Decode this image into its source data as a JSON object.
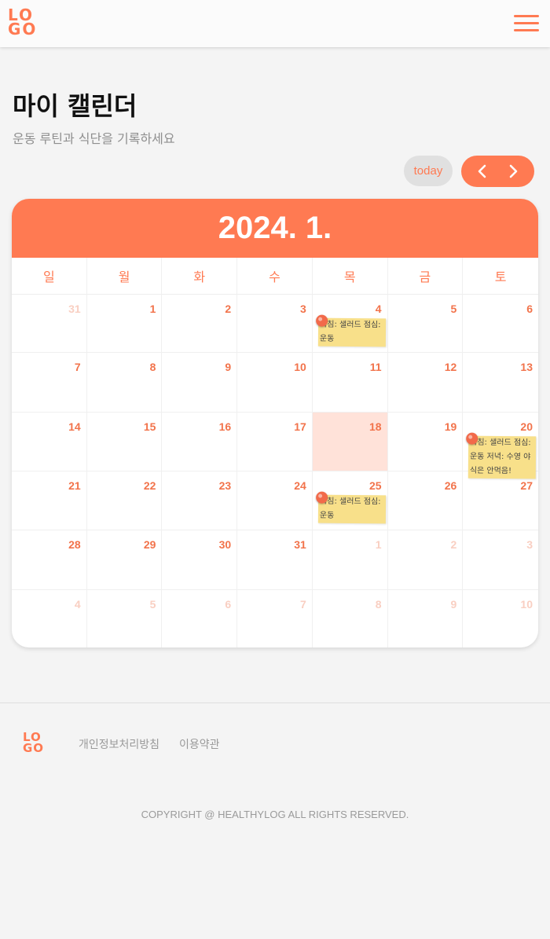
{
  "header": {
    "logo_top": "LO",
    "logo_bottom": "GO"
  },
  "page": {
    "title": "마이 캘린더",
    "subtitle": "운동 루틴과 식단을 기록하세요"
  },
  "controls": {
    "today_label": "today"
  },
  "calendar": {
    "month_label": "2024. 1.",
    "weekdays": [
      "일",
      "월",
      "화",
      "수",
      "목",
      "금",
      "토"
    ],
    "days": [
      {
        "n": "31",
        "muted": true
      },
      {
        "n": "1"
      },
      {
        "n": "2"
      },
      {
        "n": "3"
      },
      {
        "n": "4",
        "note": "아침: 샐러드 점심: 운동"
      },
      {
        "n": "5"
      },
      {
        "n": "6"
      },
      {
        "n": "7"
      },
      {
        "n": "8"
      },
      {
        "n": "9"
      },
      {
        "n": "10"
      },
      {
        "n": "11"
      },
      {
        "n": "12"
      },
      {
        "n": "13"
      },
      {
        "n": "14"
      },
      {
        "n": "15"
      },
      {
        "n": "16"
      },
      {
        "n": "17"
      },
      {
        "n": "18",
        "today": true
      },
      {
        "n": "19"
      },
      {
        "n": "20",
        "note": "아침: 샐러드 점심: 운동 저녁: 수영 야식은 안먹음!"
      },
      {
        "n": "21"
      },
      {
        "n": "22"
      },
      {
        "n": "23"
      },
      {
        "n": "24"
      },
      {
        "n": "25",
        "note": "아침: 샐러드 점심: 운동"
      },
      {
        "n": "26"
      },
      {
        "n": "27"
      },
      {
        "n": "28"
      },
      {
        "n": "29"
      },
      {
        "n": "30"
      },
      {
        "n": "31"
      },
      {
        "n": "1",
        "muted": true
      },
      {
        "n": "2",
        "muted": true
      },
      {
        "n": "3",
        "muted": true
      },
      {
        "n": "4",
        "muted": true
      },
      {
        "n": "5",
        "muted": true
      },
      {
        "n": "6",
        "muted": true
      },
      {
        "n": "7",
        "muted": true
      },
      {
        "n": "8",
        "muted": true
      },
      {
        "n": "9",
        "muted": true
      },
      {
        "n": "10",
        "muted": true
      }
    ]
  },
  "footer": {
    "logo_top": "LO",
    "logo_bottom": "GO",
    "privacy_link": "개인정보처리방침",
    "terms_link": "이용약관",
    "copyright": "COPYRIGHT @ HEALTHYLOG ALL RIGHTS RESERVED."
  },
  "colors": {
    "accent": "#ff7a52",
    "today_bg": "#ffe2d9",
    "note_bg": "#f8e08a"
  }
}
